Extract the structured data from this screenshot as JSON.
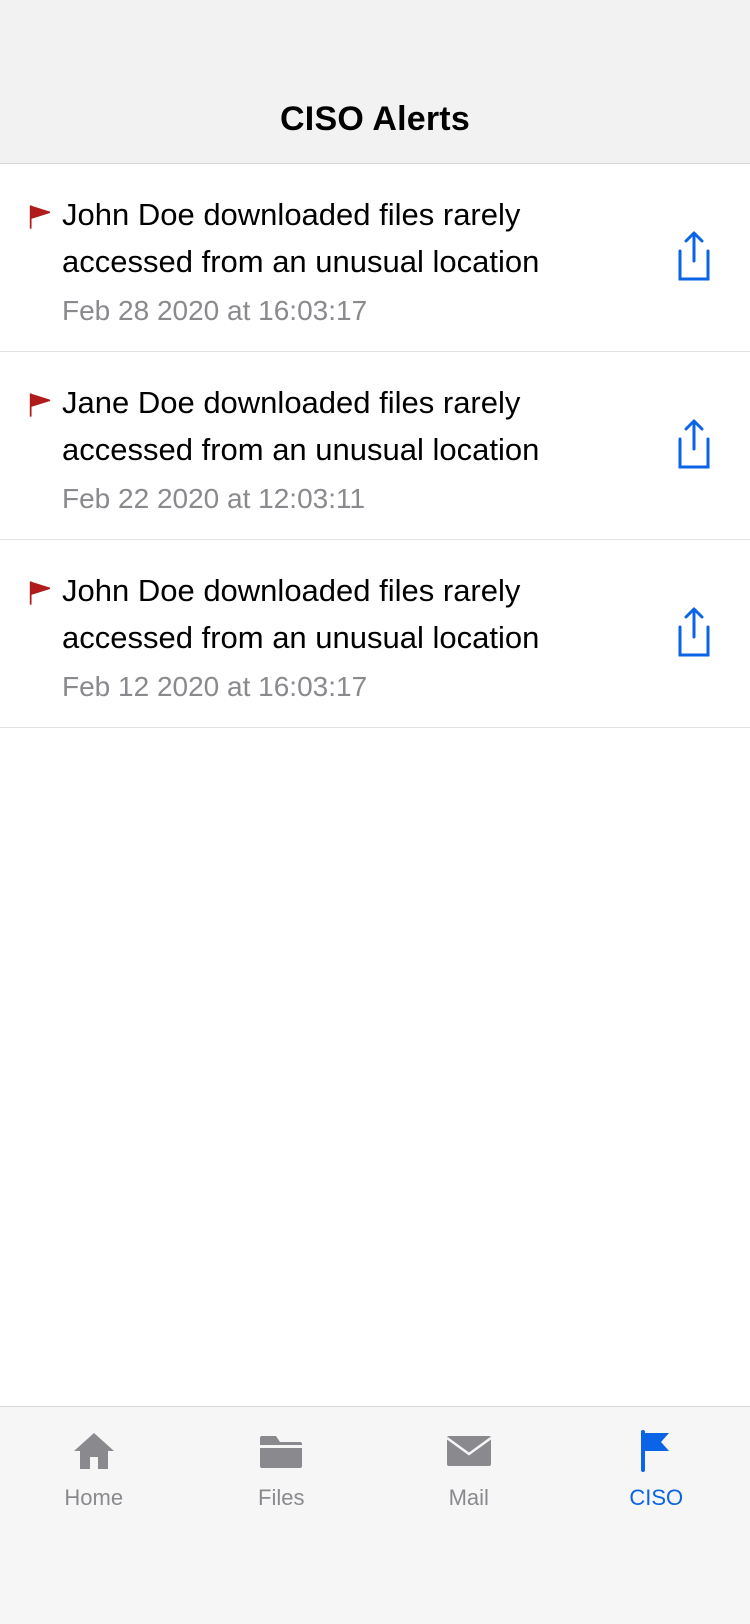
{
  "header": {
    "title": "CISO Alerts"
  },
  "colors": {
    "accent": "#0b63e5",
    "flag": "#b01b1b",
    "inactive": "#8a8a8e"
  },
  "alerts": [
    {
      "title": "John Doe downloaded files rarely accessed from an unusual location",
      "timestamp": "Feb 28 2020 at 16:03:17"
    },
    {
      "title": "Jane Doe downloaded files rarely accessed from an unusual location",
      "timestamp": "Feb 22 2020 at 12:03:11"
    },
    {
      "title": "John Doe downloaded files rarely accessed from an unusual location",
      "timestamp": "Feb 12 2020 at 16:03:17"
    }
  ],
  "tabs": [
    {
      "label": "Home",
      "icon": "home-icon",
      "active": false
    },
    {
      "label": "Files",
      "icon": "folder-icon",
      "active": false
    },
    {
      "label": "Mail",
      "icon": "mail-icon",
      "active": false
    },
    {
      "label": "CISO",
      "icon": "flag-icon",
      "active": true
    }
  ]
}
